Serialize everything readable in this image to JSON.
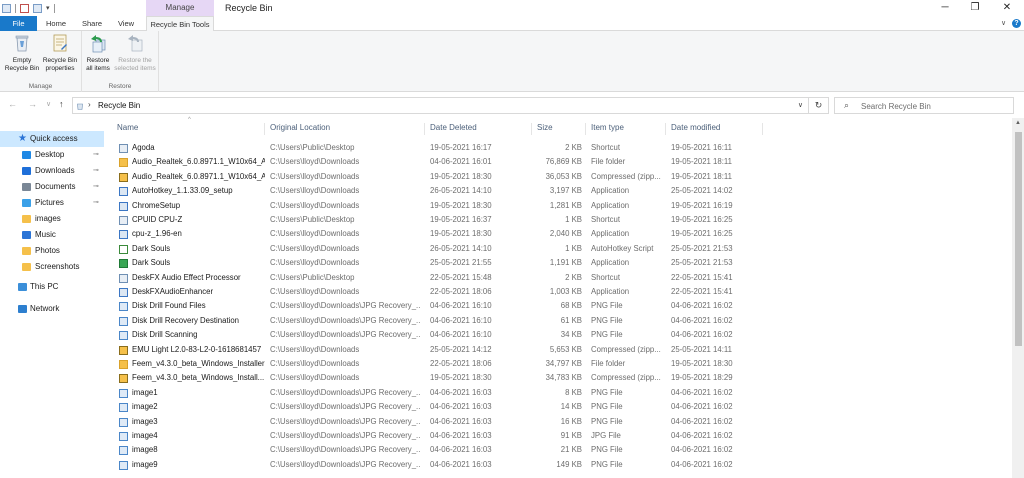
{
  "window": {
    "title": "Recycle Bin",
    "context_tab_group": "Manage",
    "controls": {
      "minimize": "─",
      "maximize": "❐",
      "close": "✕"
    }
  },
  "quick_access_toolbar": {
    "dropdown": "▾"
  },
  "ribbon_tabs": [
    "File",
    "Home",
    "Share",
    "View",
    "Recycle Bin Tools"
  ],
  "ribbon": {
    "manage_group": {
      "label": "Manage",
      "empty": [
        "Empty",
        "Recycle Bin"
      ],
      "properties": [
        "Recycle Bin",
        "properties"
      ]
    },
    "restore_group": {
      "label": "Restore",
      "restore_all": [
        "Restore",
        "all items"
      ],
      "restore_selected": [
        "Restore the",
        "selected items"
      ]
    }
  },
  "address": {
    "back": "←",
    "forward": "→",
    "recent": "∨",
    "up": "↑",
    "chevron": "›",
    "path": "Recycle Bin",
    "dropdown": "∨",
    "refresh": "↻"
  },
  "search": {
    "placeholder": "Search Recycle Bin",
    "icon": "search-icon"
  },
  "nav_pane": {
    "quick_access": "Quick access",
    "pinned": [
      {
        "label": "Desktop",
        "pinned": true,
        "icon": "desktop-icon",
        "color": "#1e88e5"
      },
      {
        "label": "Downloads",
        "pinned": true,
        "icon": "downloads-icon",
        "color": "#1e6fd9"
      },
      {
        "label": "Documents",
        "pinned": true,
        "icon": "documents-icon",
        "color": "#7a8796"
      },
      {
        "label": "Pictures",
        "pinned": true,
        "icon": "pictures-icon",
        "color": "#3aa0e8"
      },
      {
        "label": "images",
        "pinned": false,
        "icon": "folder-icon",
        "color": "#f5c04a"
      },
      {
        "label": "Music",
        "pinned": false,
        "icon": "music-icon",
        "color": "#2b74d6"
      },
      {
        "label": "Photos",
        "pinned": false,
        "icon": "folder-icon",
        "color": "#f5c04a"
      },
      {
        "label": "Screenshots",
        "pinned": false,
        "icon": "folder-icon",
        "color": "#f5c04a"
      }
    ],
    "this_pc": "This PC",
    "network": "Network",
    "pin_glyph": "📌"
  },
  "columns": [
    "Name",
    "Original Location",
    "Date Deleted",
    "Size",
    "Item type",
    "Date modified"
  ],
  "sort_indicator": "^",
  "files": [
    {
      "name": "Agoda",
      "location": "C:\\Users\\Public\\Desktop",
      "deleted": "19-05-2021 16:17",
      "size": "2 KB",
      "type": "Shortcut",
      "modified": "19-05-2021 16:11",
      "icon": "shortcut-icon"
    },
    {
      "name": "Audio_Realtek_6.0.8971.1_W10x64_A",
      "location": "C:\\Users\\lloyd\\Downloads",
      "deleted": "04-06-2021 16:01",
      "size": "76,869 KB",
      "type": "File folder",
      "modified": "19-05-2021 18:11",
      "icon": "folder-icon"
    },
    {
      "name": "Audio_Realtek_6.0.8971.1_W10x64_A",
      "location": "C:\\Users\\lloyd\\Downloads",
      "deleted": "19-05-2021 18:30",
      "size": "36,053 KB",
      "type": "Compressed (zipp...",
      "modified": "19-05-2021 18:11",
      "icon": "zip-icon"
    },
    {
      "name": "AutoHotkey_1.1.33.09_setup",
      "location": "C:\\Users\\lloyd\\Downloads",
      "deleted": "26-05-2021 14:10",
      "size": "3,197 KB",
      "type": "Application",
      "modified": "25-05-2021 14:02",
      "icon": "app-icon"
    },
    {
      "name": "ChromeSetup",
      "location": "C:\\Users\\lloyd\\Downloads",
      "deleted": "19-05-2021 18:30",
      "size": "1,281 KB",
      "type": "Application",
      "modified": "19-05-2021 16:19",
      "icon": "app-icon"
    },
    {
      "name": "CPUID CPU-Z",
      "location": "C:\\Users\\Public\\Desktop",
      "deleted": "19-05-2021 16:37",
      "size": "1 KB",
      "type": "Shortcut",
      "modified": "19-05-2021 16:25",
      "icon": "shortcut-icon"
    },
    {
      "name": "cpu-z_1.96-en",
      "location": "C:\\Users\\lloyd\\Downloads",
      "deleted": "19-05-2021 18:30",
      "size": "2,040 KB",
      "type": "Application",
      "modified": "19-05-2021 16:25",
      "icon": "app-icon"
    },
    {
      "name": "Dark Souls",
      "location": "C:\\Users\\lloyd\\Downloads",
      "deleted": "26-05-2021 14:10",
      "size": "1 KB",
      "type": "AutoHotkey Script",
      "modified": "25-05-2021 21:53",
      "icon": "ahk-icon"
    },
    {
      "name": "Dark Souls",
      "location": "C:\\Users\\lloyd\\Downloads",
      "deleted": "25-05-2021 21:55",
      "size": "1,191 KB",
      "type": "Application",
      "modified": "25-05-2021 21:53",
      "icon": "app-green-icon"
    },
    {
      "name": "DeskFX Audio Effect Processor",
      "location": "C:\\Users\\Public\\Desktop",
      "deleted": "22-05-2021 15:48",
      "size": "2 KB",
      "type": "Shortcut",
      "modified": "22-05-2021 15:41",
      "icon": "shortcut-icon"
    },
    {
      "name": "DeskFXAudioEnhancer",
      "location": "C:\\Users\\lloyd\\Downloads",
      "deleted": "22-05-2021 18:06",
      "size": "1,003 KB",
      "type": "Application",
      "modified": "22-05-2021 15:41",
      "icon": "app-icon"
    },
    {
      "name": "Disk Drill Found Files",
      "location": "C:\\Users\\lloyd\\Downloads\\JPG Recovery_...",
      "deleted": "04-06-2021 16:10",
      "size": "68 KB",
      "type": "PNG File",
      "modified": "04-06-2021 16:02",
      "icon": "image-icon"
    },
    {
      "name": "Disk Drill Recovery Destination",
      "location": "C:\\Users\\lloyd\\Downloads\\JPG Recovery_...",
      "deleted": "04-06-2021 16:10",
      "size": "61 KB",
      "type": "PNG File",
      "modified": "04-06-2021 16:02",
      "icon": "image-icon"
    },
    {
      "name": "Disk Drill Scanning",
      "location": "C:\\Users\\lloyd\\Downloads\\JPG Recovery_...",
      "deleted": "04-06-2021 16:10",
      "size": "34 KB",
      "type": "PNG File",
      "modified": "04-06-2021 16:02",
      "icon": "image-icon"
    },
    {
      "name": "EMU Light L2.0-83-L2-0-1618681457",
      "location": "C:\\Users\\lloyd\\Downloads",
      "deleted": "25-05-2021 14:12",
      "size": "5,653 KB",
      "type": "Compressed (zipp...",
      "modified": "25-05-2021 14:11",
      "icon": "zip-icon"
    },
    {
      "name": "Feem_v4.3.0_beta_Windows_Installer",
      "location": "C:\\Users\\lloyd\\Downloads",
      "deleted": "22-05-2021 18:06",
      "size": "34,797 KB",
      "type": "File folder",
      "modified": "19-05-2021 18:30",
      "icon": "folder-icon"
    },
    {
      "name": "Feem_v4.3.0_beta_Windows_Install...",
      "location": "C:\\Users\\lloyd\\Downloads",
      "deleted": "19-05-2021 18:30",
      "size": "34,783 KB",
      "type": "Compressed (zipp...",
      "modified": "19-05-2021 18:29",
      "icon": "zip-icon"
    },
    {
      "name": "image1",
      "location": "C:\\Users\\lloyd\\Downloads\\JPG Recovery_...",
      "deleted": "04-06-2021 16:03",
      "size": "8 KB",
      "type": "PNG File",
      "modified": "04-06-2021 16:02",
      "icon": "image-icon"
    },
    {
      "name": "image2",
      "location": "C:\\Users\\lloyd\\Downloads\\JPG Recovery_...",
      "deleted": "04-06-2021 16:03",
      "size": "14 KB",
      "type": "PNG File",
      "modified": "04-06-2021 16:02",
      "icon": "image-icon"
    },
    {
      "name": "image3",
      "location": "C:\\Users\\lloyd\\Downloads\\JPG Recovery_...",
      "deleted": "04-06-2021 16:03",
      "size": "16 KB",
      "type": "PNG File",
      "modified": "04-06-2021 16:02",
      "icon": "image-icon"
    },
    {
      "name": "image4",
      "location": "C:\\Users\\lloyd\\Downloads\\JPG Recovery_...",
      "deleted": "04-06-2021 16:03",
      "size": "91 KB",
      "type": "JPG File",
      "modified": "04-06-2021 16:02",
      "icon": "image-icon"
    },
    {
      "name": "image8",
      "location": "C:\\Users\\lloyd\\Downloads\\JPG Recovery_...",
      "deleted": "04-06-2021 16:03",
      "size": "21 KB",
      "type": "PNG File",
      "modified": "04-06-2021 16:02",
      "icon": "image-icon"
    },
    {
      "name": "image9",
      "location": "C:\\Users\\lloyd\\Downloads\\JPG Recovery_...",
      "deleted": "04-06-2021 16:03",
      "size": "149 KB",
      "type": "PNG File",
      "modified": "04-06-2021 16:02",
      "icon": "image-icon"
    }
  ],
  "colors": {
    "file_tab": "#1979ca",
    "manage_tab": "#e6d7f5",
    "nav_selected": "#cce8ff",
    "header_text": "#4c607a",
    "folder": "#f5c04a"
  }
}
